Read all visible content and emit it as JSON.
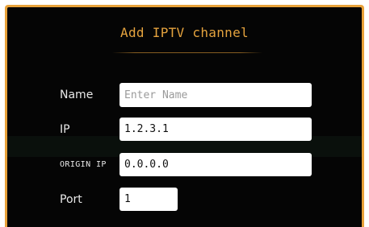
{
  "dialog": {
    "title": "Add IPTV channel"
  },
  "form": {
    "name": {
      "label": "Name",
      "value": "",
      "placeholder": "Enter Name"
    },
    "ip": {
      "label": "IP",
      "value": "1.2.3.1",
      "placeholder": ""
    },
    "origin_ip": {
      "label": "ORIGIN IP",
      "value": "0.0.0.0",
      "placeholder": ""
    },
    "port": {
      "label": "Port",
      "value": "1",
      "placeholder": ""
    }
  },
  "colors": {
    "accent": "#e5a33e",
    "background": "#050505",
    "field": "#ffffff"
  }
}
